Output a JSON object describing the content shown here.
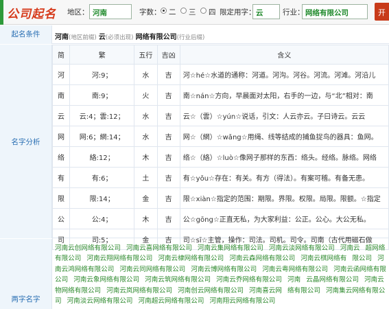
{
  "topbar": {
    "title": "公司起名",
    "region_label": "地区：",
    "region_value": "河南",
    "chars_label": "字数：",
    "options": [
      "二",
      "三",
      "四"
    ],
    "selected_option": "二",
    "fixed_label": "限定用字：",
    "fixed_value": "云",
    "industry_label": "行业：",
    "industry_value": "网络有限公司",
    "submit_label": "开"
  },
  "conditions": {
    "label": "起名条件",
    "region": "河南",
    "region_note": "(地区前缀)",
    "fixed": "云",
    "fixed_note": "(必须出现)",
    "industry": "网络有限公司",
    "industry_note": "(行业后缀)"
  },
  "analysis": {
    "label": "名字分析",
    "headers": [
      "简",
      "繁",
      "五行",
      "吉凶",
      "含义"
    ],
    "rows": [
      {
        "simp": "河",
        "trad": "河:9；",
        "element": "水",
        "luck": "吉",
        "meaning": "河☆hé☆水道的通称：河道。河沟。河谷。河流。河滩。河沿儿"
      },
      {
        "simp": "南",
        "trad": "南:9；",
        "element": "火",
        "luck": "吉",
        "meaning": "南☆nán☆方向，早晨面对太阳，右手的一边，与“北”相对：南"
      },
      {
        "simp": "云",
        "trad": "云:4；雲:12；",
        "element": "水",
        "luck": "吉",
        "meaning": "云☆（雲）☆yún☆说话，引文：人云亦云。子曰诗云。云云"
      },
      {
        "simp": "网",
        "trad": "网:6；網:14；",
        "element": "水",
        "luck": "吉",
        "meaning": "网☆（網）☆wǎng☆用绳、线等结成的捕鱼捉鸟的器具：鱼网。"
      },
      {
        "simp": "络",
        "trad": "絡:12；",
        "element": "木",
        "luck": "吉",
        "meaning": "络☆（絡）☆luò☆像网子那样的东西：络头。经络。脉络。网络"
      },
      {
        "simp": "有",
        "trad": "有:6；",
        "element": "土",
        "luck": "吉",
        "meaning": "有☆yǒu☆存在：有关。有方（得法）。有案可稽。有备无患。"
      },
      {
        "simp": "限",
        "trad": "限:14；",
        "element": "金",
        "luck": "吉",
        "meaning": "限☆xiàn☆指定的范围：期限。界限。权限。局限。限额。☆指定"
      },
      {
        "simp": "公",
        "trad": "公:4；",
        "element": "木",
        "luck": "吉",
        "meaning": "公☆gōng☆正直无私，为大家利益：公正。公心。大公无私。"
      },
      {
        "simp": "司",
        "trad": "司:5；",
        "element": "金",
        "luck": "吉",
        "meaning": "司☆sī☆主管，操作：司法。司机。司令。司南（古代用磁石做"
      }
    ]
  },
  "names": {
    "label": "两字名字",
    "items": [
      "河南云创网络有限公司",
      "河南云喜网络有限公司",
      "河南云集网络有限公司",
      "河南云淡网络有限公司",
      "河南云",
      "超网络有限公司",
      "河南云翔网络有限公司",
      "河南云棣网络有限公司",
      "河南云森网络有限公司",
      "河南云棋网络有",
      "限公司",
      "河南云鸿网络有限公司",
      "河南云同网络有限公司",
      "河南云博网络有限公司",
      "河南云粤网络有限公司",
      "河南云函网络有限公司",
      "河南云象网络有限公司",
      "河南云筑网络有限公司",
      "河南云乔网络有限公司",
      "河南",
      "云晶网络有限公司",
      "河南云物网络有限公司",
      "河南云岚网络有限公司",
      "河南创云网络有限公司",
      "河南喜云网",
      "络有限公司",
      "河南集云网络有限公司",
      "河南淡云网络有限公司",
      "河南超云网络有限公司",
      "河南翔云网络有限公司"
    ]
  }
}
